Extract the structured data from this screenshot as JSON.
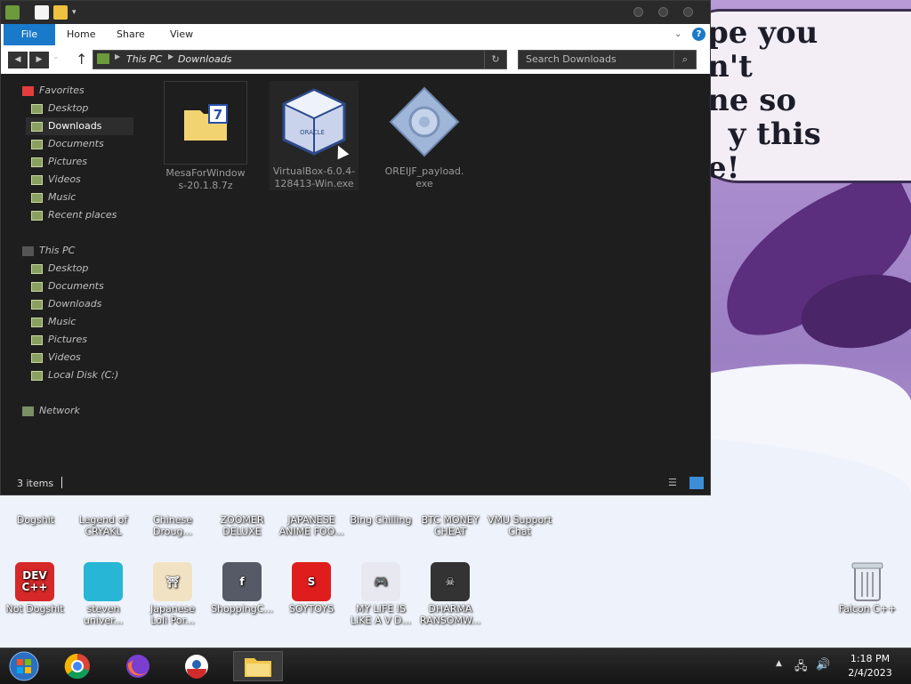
{
  "wallpaper": {
    "bubble_text": "pe you\nn't\nne so\n  y this\ne!"
  },
  "explorer": {
    "ribbon_tabs": [
      "File",
      "Home",
      "Share",
      "View"
    ],
    "address": {
      "root": "This PC",
      "folder": "Downloads"
    },
    "search_placeholder": "Search Downloads",
    "nav": {
      "favorites_label": "Favorites",
      "favorites": [
        "Desktop",
        "Downloads",
        "Documents",
        "Pictures",
        "Videos",
        "Music",
        "Recent places"
      ],
      "thispc_label": "This PC",
      "thispc": [
        "Desktop",
        "Documents",
        "Downloads",
        "Music",
        "Pictures",
        "Videos",
        "Local Disk (C:)"
      ],
      "network_label": "Network"
    },
    "files": [
      {
        "name_line1": "MesaForWindow",
        "name_line2": "s-20.1.8.7z",
        "icon": "7zip-archive-icon"
      },
      {
        "name_line1": "VirtualBox-6.0.4-",
        "name_line2": "128413-Win.exe",
        "icon": "virtualbox-icon"
      },
      {
        "name_line1": "OREIJF_payload.",
        "name_line2": "exe",
        "icon": "executable-icon"
      }
    ],
    "status": "3 items"
  },
  "desktop_row1": [
    {
      "line1": "Dogshit",
      "line2": ""
    },
    {
      "line1": "Legend of",
      "line2": "CRYAKL"
    },
    {
      "line1": "Chinese",
      "line2": "Droug..."
    },
    {
      "line1": "ZOOMER",
      "line2": "DELUXE"
    },
    {
      "line1": "JAPANESE",
      "line2": "ANIME FOO..."
    },
    {
      "line1": "Bing Chilling",
      "line2": ""
    },
    {
      "line1": "BTC MONEY",
      "line2": "CHEAT"
    },
    {
      "line1": "VMU Support",
      "line2": "Chat"
    }
  ],
  "desktop_row2": [
    {
      "line1": "Not Dogshit",
      "line2": "",
      "badge": "DEV\nC++",
      "color": "#d62828"
    },
    {
      "line1": "steven",
      "line2": "univer...",
      "badge": "",
      "color": "#27b6d6"
    },
    {
      "line1": "Japanese",
      "line2": "Loli Por...",
      "badge": "⛩",
      "color": "#f2e2c4"
    },
    {
      "line1": "ShoppingC...",
      "line2": "",
      "badge": "f",
      "color": "#555a66"
    },
    {
      "line1": "SOYTOYS",
      "line2": "",
      "badge": "S",
      "color": "#e01d1d"
    },
    {
      "line1": "MY LIFE IS",
      "line2": "LIKE A V D...",
      "badge": "🎮",
      "color": "#e8e8f0"
    },
    {
      "line1": "DHARMA",
      "line2": "RANSOMW...",
      "badge": "☠",
      "color": "#333"
    }
  ],
  "recycle_bin": {
    "label": "Falcon C++"
  },
  "taskbar": {
    "time": "1:18 PM",
    "date": "2/4/2023"
  }
}
